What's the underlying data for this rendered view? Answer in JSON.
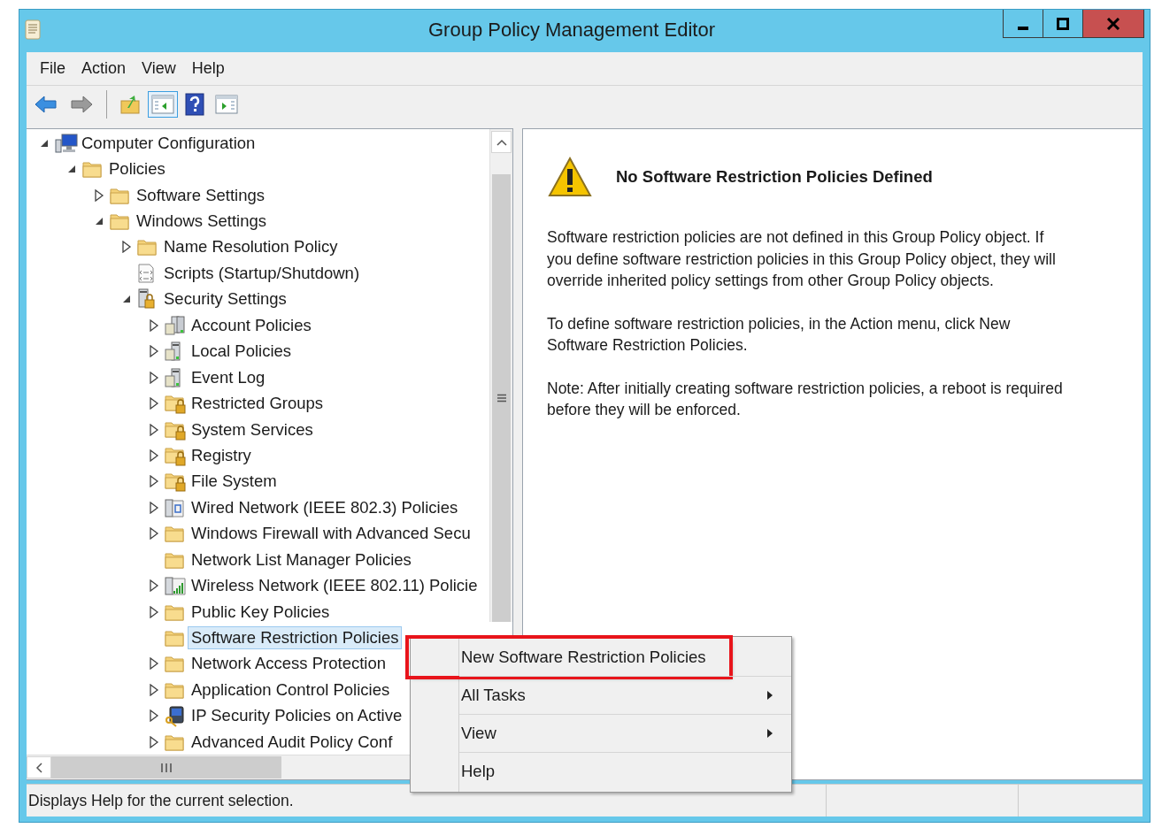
{
  "window": {
    "title": "Group Policy Management Editor"
  },
  "menu_bar": [
    "File",
    "Action",
    "View",
    "Help"
  ],
  "toolbar": [
    {
      "kind": "back",
      "pressed": false
    },
    {
      "kind": "forward",
      "pressed": false
    },
    {
      "kind": "up",
      "pressed": false
    },
    {
      "kind": "tree",
      "pressed": true
    },
    {
      "kind": "help",
      "pressed": false
    },
    {
      "kind": "pane",
      "pressed": false
    }
  ],
  "tree": [
    {
      "label": "Computer Configuration",
      "kind": "computer",
      "expanded": true,
      "selected": false,
      "children": [
        {
          "label": "Policies",
          "kind": "folder",
          "expanded": true,
          "selected": false,
          "children": [
            {
              "label": "Software Settings",
              "kind": "folder",
              "expanded": false,
              "selected": false
            },
            {
              "label": "Windows Settings",
              "kind": "folder",
              "expanded": true,
              "selected": false,
              "children": [
                {
                  "label": "Name Resolution Policy",
                  "kind": "folder",
                  "expanded": false,
                  "selected": false
                },
                {
                  "label": "Scripts (Startup/Shutdown)",
                  "kind": "script",
                  "selected": false
                },
                {
                  "label": "Security Settings",
                  "kind": "security",
                  "expanded": true,
                  "selected": false,
                  "children": [
                    {
                      "label": "Account Policies",
                      "kind": "servers",
                      "expanded": false,
                      "selected": false
                    },
                    {
                      "label": "Local Policies",
                      "kind": "server",
                      "expanded": false,
                      "selected": false
                    },
                    {
                      "label": "Event Log",
                      "kind": "server",
                      "expanded": false,
                      "selected": false
                    },
                    {
                      "label": "Restricted Groups",
                      "kind": "lockfolder",
                      "expanded": false,
                      "selected": false
                    },
                    {
                      "label": "System Services",
                      "kind": "lockfolder",
                      "expanded": false,
                      "selected": false
                    },
                    {
                      "label": "Registry",
                      "kind": "lockfolder",
                      "expanded": false,
                      "selected": false
                    },
                    {
                      "label": "File System",
                      "kind": "lockfolder",
                      "expanded": false,
                      "selected": false
                    },
                    {
                      "label": "Wired Network (IEEE 802.3) Policies",
                      "kind": "wired",
                      "expanded": false,
                      "selected": false
                    },
                    {
                      "label": "Windows Firewall with Advanced Secu",
                      "kind": "folder",
                      "expanded": false,
                      "selected": false
                    },
                    {
                      "label": "Network List Manager Policies",
                      "kind": "folder",
                      "selected": false
                    },
                    {
                      "label": "Wireless Network (IEEE 802.11) Policie",
                      "kind": "wireless",
                      "expanded": false,
                      "selected": false
                    },
                    {
                      "label": "Public Key Policies",
                      "kind": "folder",
                      "expanded": false,
                      "selected": false
                    },
                    {
                      "label": "Software Restriction Policies",
                      "kind": "folder",
                      "selected": true
                    },
                    {
                      "label": "Network Access Protection",
                      "kind": "folder",
                      "expanded": false,
                      "selected": false
                    },
                    {
                      "label": "Application Control Policies",
                      "kind": "folder",
                      "expanded": false,
                      "selected": false
                    },
                    {
                      "label": "IP Security Policies on Active",
                      "kind": "ipsec",
                      "expanded": false,
                      "selected": false
                    },
                    {
                      "label": "Advanced Audit Policy Conf",
                      "kind": "folder",
                      "expanded": false,
                      "selected": false
                    }
                  ]
                }
              ]
            }
          ]
        }
      ]
    }
  ],
  "details": {
    "heading": "No Software Restriction Policies Defined",
    "paragraphs": [
      "Software restriction policies are not defined in this Group Policy object. If you define software restriction policies in this Group Policy object, they will override inherited policy settings from other Group Policy objects.",
      "To define software restriction policies, in the Action menu, click New Software Restriction Policies.",
      "Note: After initially creating software restriction policies, a reboot is required before they will be enforced."
    ]
  },
  "context_menu": [
    {
      "label": "New Software Restriction Policies",
      "submenu": false,
      "annotated": true
    },
    {
      "label": "All Tasks",
      "submenu": true,
      "annotated": false
    },
    {
      "label": "View",
      "submenu": true,
      "annotated": false
    },
    {
      "label": "Help",
      "submenu": false,
      "annotated": false
    }
  ],
  "status_bar": {
    "text": "Displays Help for the current selection."
  }
}
